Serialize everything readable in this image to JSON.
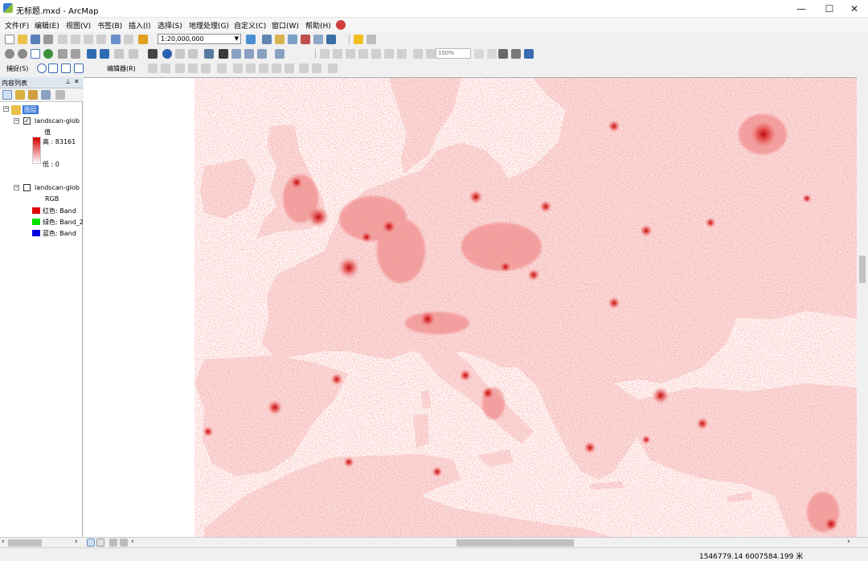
{
  "window": {
    "title": "无标题.mxd - ArcMap",
    "minimize_glyph": "—",
    "maximize_glyph": "☐",
    "close_glyph": "✕"
  },
  "menu": [
    "文件(F)",
    "编辑(E)",
    "视图(V)",
    "书签(B)",
    "插入(I)",
    "选择(S)",
    "地理处理(G)",
    "自定义(C)",
    "窗口(W)",
    "帮助(H)"
  ],
  "toolbar": {
    "scale": "1:20,000,000",
    "zoom_percent": "100%",
    "snapping_label": "捕捉(S)",
    "editor_label": "编辑器(R)"
  },
  "toc": {
    "title": "内容列表",
    "pin_glyph": "⊥",
    "close_glyph": "✕",
    "dataframe": "图层",
    "layer1": {
      "name": "landscan-glob",
      "checked": true,
      "field_label": "值",
      "high_label": "高 : 83161",
      "low_label": "低 : 0"
    },
    "layer2": {
      "name": "landscan-glob",
      "checked": false,
      "rgb_label": "RGB",
      "bands": [
        {
          "label": "红色:   Band",
          "color": "#e00000"
        },
        {
          "label": "绿色: Band_2",
          "color": "#00e000"
        },
        {
          "label": "蓝色:   Band",
          "color": "#0000e0"
        }
      ]
    }
  },
  "status": {
    "coordinates": "1546779.14  6007584.199 米"
  },
  "colors": {
    "ramp_high": "#d40000",
    "ramp_low": "#ffffff",
    "population": "#e2352f",
    "land_tint": "#fbe2e2"
  }
}
